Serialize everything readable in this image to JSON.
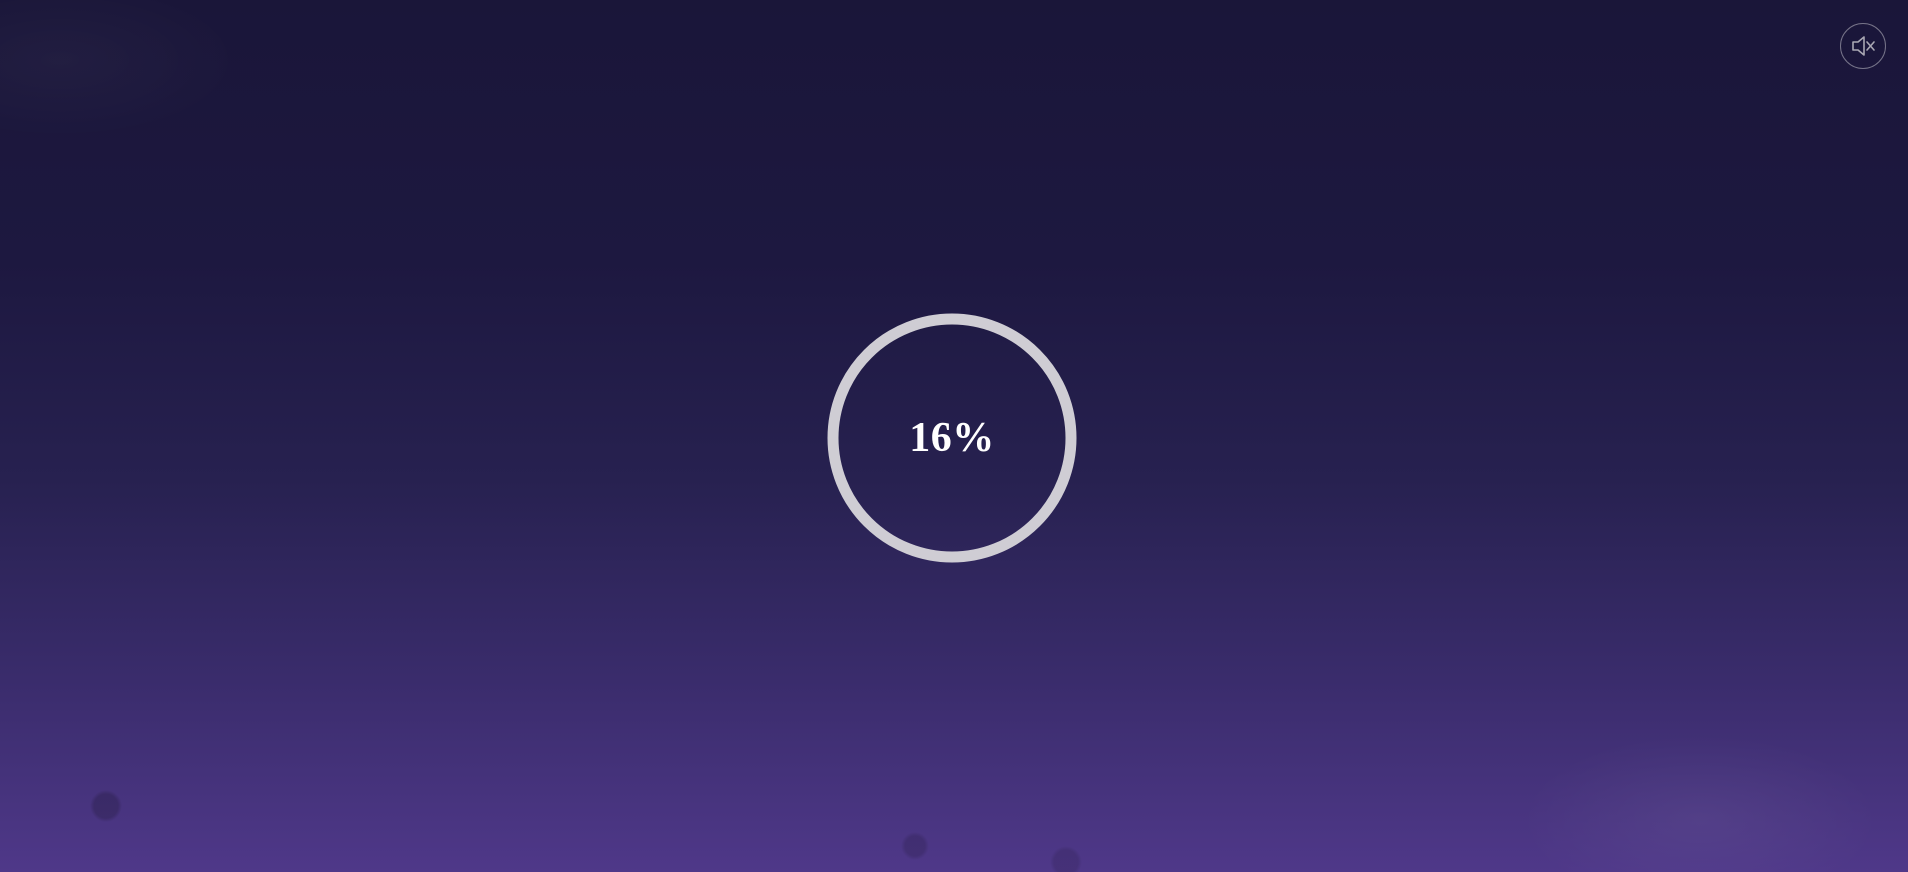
{
  "loader": {
    "progress_text": "16%",
    "progress_value": 16
  },
  "controls": {
    "mute_icon": "speaker-muted-icon"
  },
  "colors": {
    "background_top": "#1a1639",
    "background_bottom": "#4f3889",
    "ring": "#cfcdd4",
    "text": "#ffffff"
  }
}
